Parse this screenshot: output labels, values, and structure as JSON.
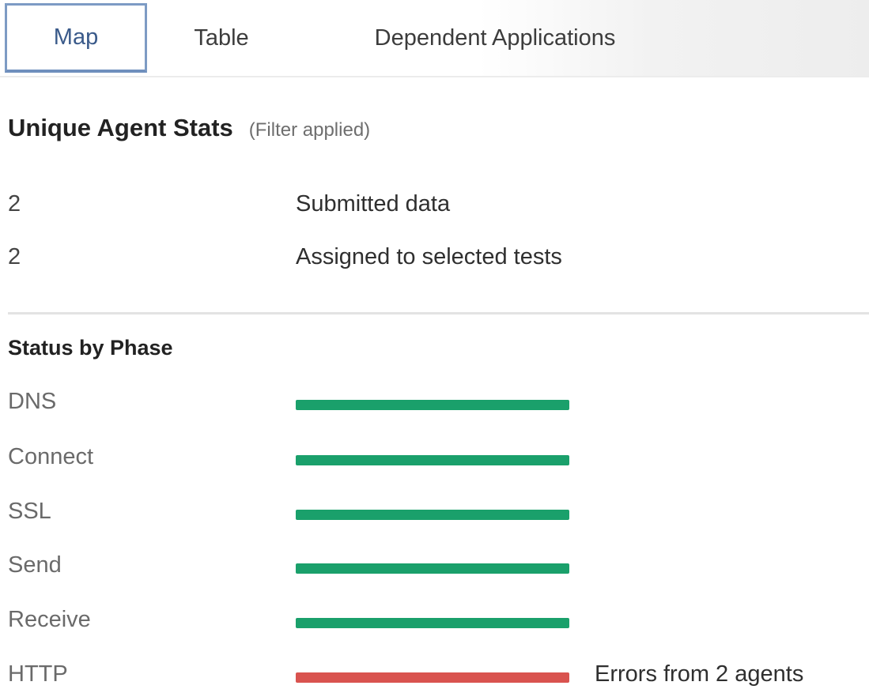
{
  "tabs": [
    {
      "label": "Map",
      "active": true
    },
    {
      "label": "Table",
      "active": false
    },
    {
      "label": "Dependent Applications",
      "active": false
    }
  ],
  "stats": {
    "title": "Unique Agent Stats",
    "note": "(Filter applied)",
    "rows": [
      {
        "value": "2",
        "label": "Submitted data"
      },
      {
        "value": "2",
        "label": "Assigned to selected tests"
      }
    ]
  },
  "phases": {
    "title": "Status by Phase",
    "colors": {
      "ok": "#1aa06b",
      "error": "#d9534f"
    },
    "rows": [
      {
        "name": "DNS",
        "status": "ok",
        "note": ""
      },
      {
        "name": "Connect",
        "status": "ok",
        "note": ""
      },
      {
        "name": "SSL",
        "status": "ok",
        "note": ""
      },
      {
        "name": "Send",
        "status": "ok",
        "note": ""
      },
      {
        "name": "Receive",
        "status": "ok",
        "note": ""
      },
      {
        "name": "HTTP",
        "status": "error",
        "note": "Errors from 2 agents"
      }
    ]
  }
}
